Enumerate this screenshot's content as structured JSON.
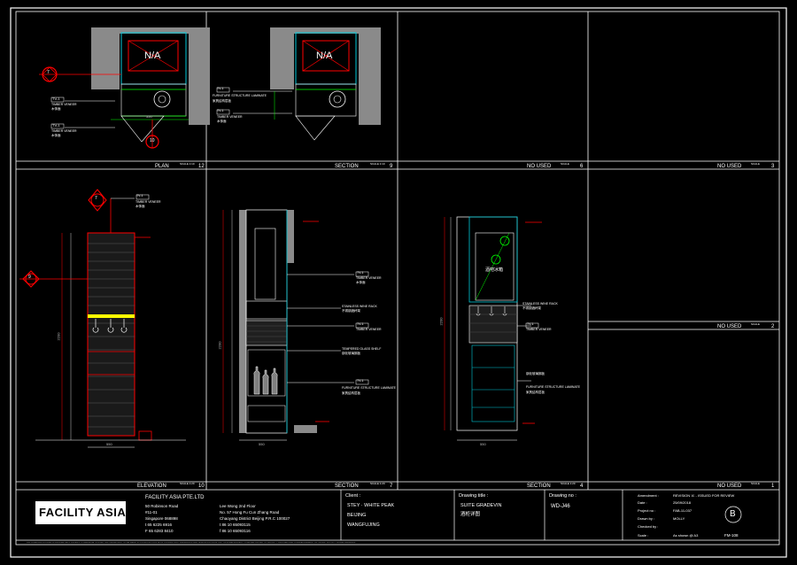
{
  "colors": {
    "background": "#000000",
    "frame": "#ffffff",
    "cyan": "#00c8d8",
    "green": "#00ff00",
    "red": "#ff0000",
    "yellow": "#ffff00",
    "gray": "#7f7f7f",
    "wall": "#a8a8a8"
  },
  "panels": [
    {
      "id": "12",
      "title": "PLAN",
      "scale": "SCALE 1:10",
      "number": "12"
    },
    {
      "id": "9",
      "title": "SECTION",
      "scale": "SCALE 1:10",
      "number": "9"
    },
    {
      "id": "6",
      "title": "NO USED",
      "scale": "SCALE",
      "number": "6"
    },
    {
      "id": "3",
      "title": "NO USED",
      "scale": "SCALE",
      "number": "3"
    },
    {
      "id": "10",
      "title": "ELEVATION",
      "scale": "SCALE 1:20",
      "number": "10"
    },
    {
      "id": "7",
      "title": "SECTION",
      "scale": "SCALE 1:20",
      "number": "7"
    },
    {
      "id": "4",
      "title": "SECTION",
      "scale": "SCALE 1:20",
      "number": "4"
    },
    {
      "id": "2",
      "title": "NO USED",
      "scale": "SCALE",
      "number": "2"
    },
    {
      "id": "1",
      "title": "NO USED",
      "scale": "SCALE",
      "number": "1"
    }
  ],
  "labels": {
    "tv1": "TV-1",
    "timber_veneer": "TIMBER VENEER",
    "timber_veneer_cn": "木饰面",
    "furniture_laminate": "FURNITURE STRUCTURE LAMINATE",
    "laminate_cn": "家具结构层板",
    "ss_wine_rack": "STAINLESS WINE RACK",
    "wine_rack_cn": "不锈钢酒杯架",
    "tempered_glass": "TEMPERED GLASS SHELF",
    "tempered_glass_cn": "钢化玻璃搁板",
    "glass_shelf_cn": "钢化玻璃搁板",
    "na": "N/A",
    "fridge_cn": "酒吧冰箱",
    "callout_a": "7",
    "callout_b": "9",
    "callout_c": "10",
    "dim_width": "550",
    "dim_height": "2200",
    "dim_small": "100"
  },
  "title_block": {
    "company_logo": "FACILITY ASIA",
    "company_name": "FACILITY ASIA PTE.LTD",
    "address": [
      "50 Robinson Road",
      "#11-01",
      "Singapore 068898",
      "t 65 6225 6916",
      "F 65 6283 8410"
    ],
    "beijing_address": [
      "Lee Wong 2nd Floor",
      "No. 57 Hong Fu Cun Zhang Road",
      "Chaoyang District Beijing P.R.C 100027",
      "t 86 10 65093115",
      "f 86 10 65093116"
    ],
    "client_label": "Client :",
    "client_lines": [
      "STEY · WHITE PEAK",
      "BEIJING",
      "WANGFUJING"
    ],
    "drawing_title_label": "Drawing title :",
    "drawing_title_lines": [
      "SUITE GRADEVIN",
      "酒柜详图"
    ],
    "drawing_no_label": "Drawing no :",
    "drawing_no": "WD-J46",
    "meta": [
      {
        "k": "Amendment :",
        "v": "REVISION 'A' - ISSUED FOR REVIEW"
      },
      {
        "k": "Date :",
        "v": "25/09/2018"
      },
      {
        "k": "Project no :",
        "v": "FAB-11-037"
      },
      {
        "k": "Drawn by :",
        "v": "MOLLY"
      },
      {
        "k": "Checked by :",
        "v": ""
      },
      {
        "k": "Scale :",
        "v": "As shown @ A3"
      }
    ],
    "revision": "B",
    "sheet_no": "FM-108",
    "footer_note": "ALL DIMENSIONS ARE IN MILLIMETERS UNLESS OTHERWISE STATED. ALL DRAWINGS TO BE READ IN CONJUNCTION WITH CONSULTANT DRAWINGS AND SPECIFICATIONS. ANY DISCREPANCIES TO BE REPORTED TO FACILITY ASIA BEFORE COMMENCEMENT OF WORK. DO NOT SCALE DRAWING."
  }
}
